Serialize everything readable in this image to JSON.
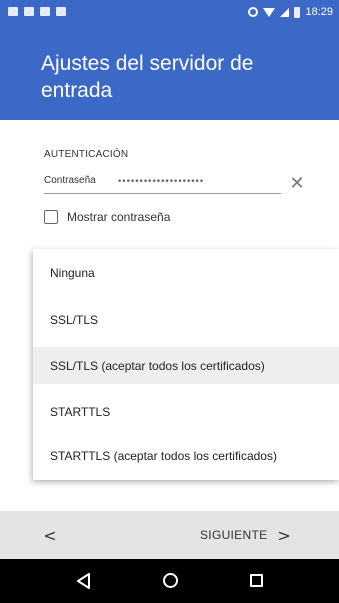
{
  "status_bar": {
    "time": "18:29",
    "notification_icons": [
      "app-icon",
      "message-icon",
      "image-icon",
      "email-icon"
    ]
  },
  "header": {
    "title": "Ajustes del servidor de entrada",
    "color": "#3c68c8"
  },
  "auth": {
    "section_label": "AUTENTICACIÓN",
    "password_label": "Contraseña",
    "password_value": "••••••••••••••••••••",
    "show_password_label": "Mostrar contraseña",
    "show_password_checked": false
  },
  "security_options": {
    "items": [
      "Ninguna",
      "SSL/TLS",
      "SSL/TLS (aceptar todos los certificados)",
      "STARTTLS",
      "STARTTLS (aceptar todos los certificados)"
    ],
    "selected": "SSL/TLS (aceptar todos los certificados)"
  },
  "footer": {
    "back_symbol": "<",
    "next_label": "SIGUIENTE",
    "next_symbol": ">"
  },
  "system_nav": {
    "icons": [
      "back-icon",
      "home-icon",
      "recents-icon"
    ]
  }
}
